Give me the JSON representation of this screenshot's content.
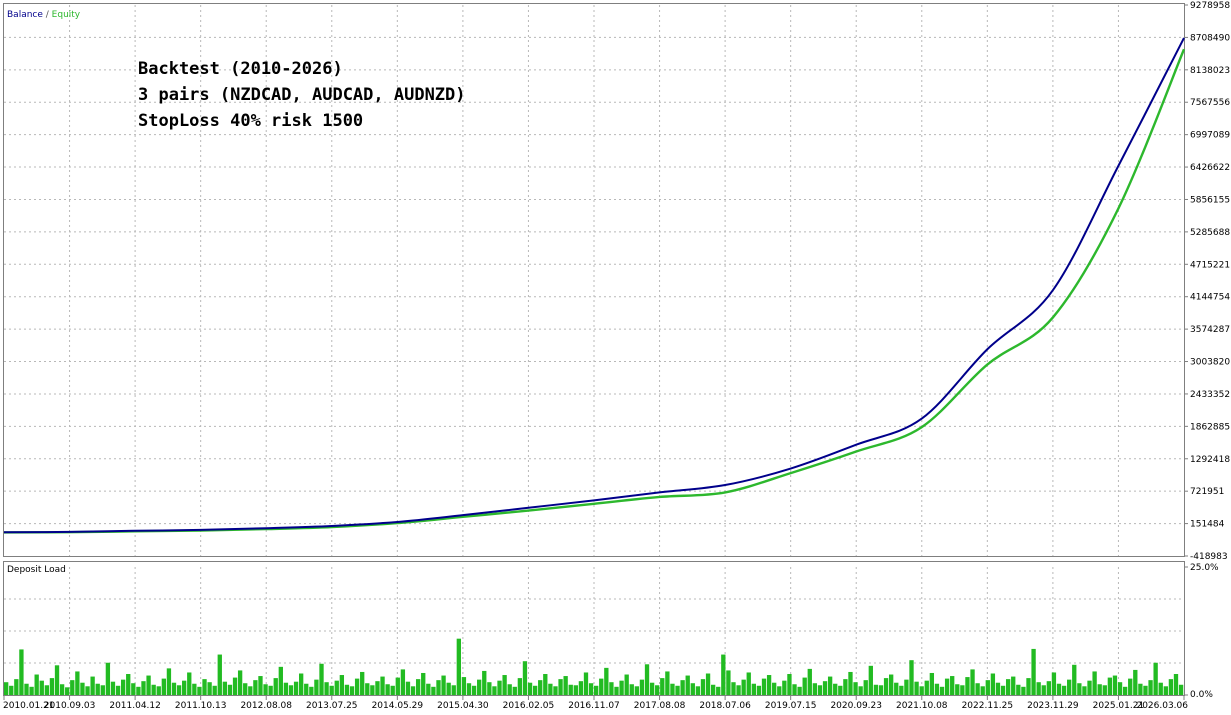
{
  "chart_data": [
    {
      "type": "line",
      "legend": {
        "items": [
          "Balance",
          "Equity"
        ],
        "separator": " / ",
        "placement": "top-left"
      },
      "annotations": [
        "Backtest (2010-2026)",
        "3 pairs (NZDCAD, AUDCAD, AUDNZD)",
        "StopLoss 40% risk 1500"
      ],
      "y_ticks": [
        "9278958",
        "8708490",
        "8138023",
        "7567556",
        "6997089",
        "6426622",
        "5856155",
        "5285688",
        "4715221",
        "4144754",
        "3574287",
        "3003820",
        "2433352",
        "1862885",
        "1292418",
        "721951",
        "151484",
        "-418983"
      ],
      "ylim": [
        -418983,
        9278958
      ],
      "x_ticks": [
        "2010.01.21",
        "2010.09.03",
        "2011.04.12",
        "2011.10.13",
        "2012.08.08",
        "2013.07.25",
        "2014.05.29",
        "2015.04.30",
        "2016.02.05",
        "2016.11.07",
        "2017.08.08",
        "2018.07.06",
        "2019.07.15",
        "2020.09.23",
        "2021.10.08",
        "2022.11.25",
        "2023.11.29",
        "2025.01.21",
        "2026.03.06"
      ],
      "grid": true,
      "series": [
        {
          "name": "Balance",
          "color": "#00008b",
          "x": [
            "2010.01.21",
            "2010.09.03",
            "2011.04.12",
            "2011.10.13",
            "2012.08.08",
            "2013.07.25",
            "2014.05.29",
            "2015.04.30",
            "2016.02.05",
            "2016.11.07",
            "2017.08.08",
            "2018.07.06",
            "2019.07.15",
            "2020.09.23",
            "2021.10.08",
            "2022.11.25",
            "2023.11.29",
            "2025.01.21",
            "2026.03.06"
          ],
          "values": [
            0,
            5000,
            25000,
            40000,
            70000,
            110000,
            180000,
            300000,
            430000,
            560000,
            700000,
            830000,
            1120000,
            1540000,
            2000000,
            3220000,
            4260000,
            6450000,
            8700000
          ]
        },
        {
          "name": "Equity",
          "color": "#2db82d",
          "x": [
            "2010.01.21",
            "2010.09.03",
            "2011.04.12",
            "2011.10.13",
            "2012.08.08",
            "2013.07.25",
            "2014.05.29",
            "2015.04.30",
            "2016.02.05",
            "2016.11.07",
            "2017.08.08",
            "2018.07.06",
            "2019.07.15",
            "2020.09.23",
            "2021.10.08",
            "2022.11.25",
            "2023.11.29",
            "2025.01.21",
            "2026.03.06"
          ],
          "values": [
            -5000,
            0,
            15000,
            30000,
            55000,
            90000,
            160000,
            270000,
            380000,
            500000,
            620000,
            700000,
            1040000,
            1420000,
            1850000,
            2950000,
            3780000,
            5700000,
            8500000
          ]
        }
      ]
    },
    {
      "type": "bar",
      "title": "Deposit Load",
      "y_ticks": [
        "25.0%",
        "0.0%"
      ],
      "ylim": [
        0,
        25
      ],
      "grid": true,
      "series": [
        {
          "name": "Deposit Load",
          "color": "#22bb22",
          "values": [
            2.5,
            1.8,
            3.1,
            8.9,
            2.2,
            1.6,
            4.0,
            2.8,
            1.9,
            3.3,
            5.8,
            2.1,
            1.5,
            2.9,
            4.6,
            2.4,
            1.7,
            3.6,
            2.2,
            1.9,
            6.3,
            2.6,
            1.8,
            3.0,
            4.1,
            2.3,
            1.6,
            2.7,
            3.8,
            2.0,
            1.7,
            3.2,
            5.2,
            2.4,
            1.9,
            2.8,
            4.4,
            2.2,
            1.6,
            3.1,
            2.5,
            1.8,
            7.9,
            2.6,
            2.0,
            3.4,
            4.8,
            2.3,
            1.7,
            2.9,
            3.7,
            2.1,
            1.8,
            3.3,
            5.5,
            2.4,
            1.9,
            2.6,
            4.2,
            2.2,
            1.6,
            3.0,
            6.1,
            2.5,
            1.8,
            2.8,
            3.9,
            2.0,
            1.7,
            3.2,
            4.5,
            2.3,
            1.9,
            2.7,
            3.6,
            2.1,
            1.8,
            3.4,
            5.0,
            2.6,
            1.7,
            3.1,
            4.3,
            2.2,
            1.6,
            2.9,
            3.8,
            2.4,
            1.9,
            11.0,
            3.5,
            2.3,
            1.8,
            3.0,
            4.7,
            2.5,
            1.7,
            2.8,
            3.9,
            2.1,
            1.6,
            3.3,
            6.6,
            2.4,
            1.8,
            2.9,
            4.1,
            2.2,
            1.7,
            3.1,
            3.7,
            2.0,
            1.9,
            2.7,
            4.4,
            2.3,
            1.8,
            3.2,
            5.3,
            2.5,
            1.6,
            2.8,
            4.0,
            2.1,
            1.7,
            3.0,
            6.0,
            2.4,
            1.9,
            3.3,
            4.6,
            2.2,
            1.8,
            2.9,
            3.8,
            2.3,
            1.7,
            3.1,
            4.2,
            2.0,
            1.6,
            7.9,
            4.8,
            2.5,
            1.9,
            3.0,
            4.4,
            2.2,
            1.8,
            3.2,
            3.9,
            2.4,
            1.7,
            2.8,
            4.1,
            2.1,
            1.6,
            3.4,
            5.1,
            2.3,
            1.9,
            2.7,
            3.6,
            2.2,
            1.8,
            3.1,
            4.5,
            2.5,
            1.7,
            2.9,
            5.7,
            2.0,
            1.9,
            3.3,
            4.0,
            2.4,
            1.8,
            3.0,
            6.8,
            2.6,
            1.7,
            2.8,
            4.3,
            2.2,
            1.6,
            3.2,
            3.7,
            2.1,
            1.9,
            3.5,
            5.0,
            2.3,
            1.7,
            2.9,
            4.2,
            2.4,
            1.8,
            3.1,
            3.6,
            2.0,
            1.6,
            3.3,
            9.0,
            2.5,
            1.9,
            2.7,
            4.4,
            2.2,
            1.8,
            3.0,
            5.9,
            2.3,
            1.7,
            2.8,
            4.6,
            2.1,
            1.9,
            3.4,
            3.8,
            2.5,
            1.6,
            3.2,
            4.9,
            2.2,
            1.8,
            2.9,
            6.3,
            2.4,
            1.7,
            3.1,
            4.1,
            2.0
          ]
        }
      ]
    }
  ]
}
